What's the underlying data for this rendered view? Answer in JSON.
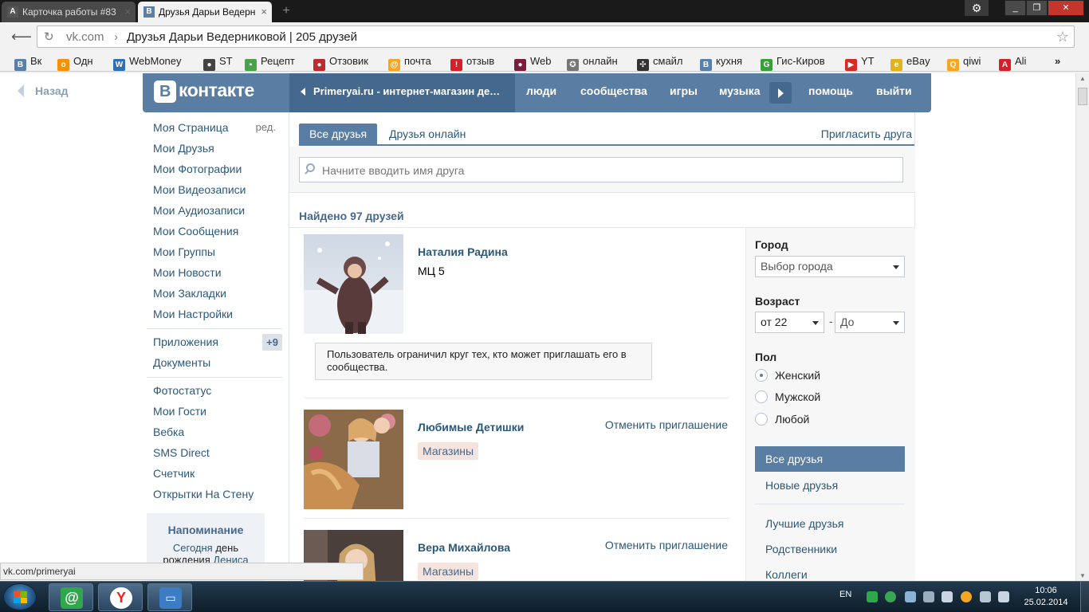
{
  "browser": {
    "tabs": [
      {
        "title": "Карточка работы #83",
        "icon": "А"
      },
      {
        "title": "Друзья Дарьи Ведерн",
        "icon": "В"
      }
    ],
    "address": {
      "host": "vk.com",
      "separator": "›",
      "path": "Друзья Дарьи Ведерниковой | 205 друзей"
    },
    "bookmarks": [
      {
        "label": "Вк",
        "icon": "В",
        "color": "#5b7fa6"
      },
      {
        "label": "Одн",
        "icon": "о",
        "color": "#f2910a"
      },
      {
        "label": "WebMoney",
        "icon": "W",
        "color": "#2f6fb2"
      },
      {
        "label": "ST",
        "icon": "●",
        "color": "#444444"
      },
      {
        "label": "Рецепт",
        "icon": "▪",
        "color": "#4aa34a"
      },
      {
        "label": "Отзовик",
        "icon": "●",
        "color": "#c0282f"
      },
      {
        "label": "почта",
        "icon": "@",
        "color": "#f5a623"
      },
      {
        "label": "отзыв",
        "icon": "!",
        "color": "#d4202a"
      },
      {
        "label": "Web",
        "icon": "●",
        "color": "#7a1e3c"
      },
      {
        "label": "онлайн",
        "icon": "✪",
        "color": "#777777"
      },
      {
        "label": "смайл",
        "icon": "✣",
        "color": "#333333"
      },
      {
        "label": "кухня",
        "icon": "В",
        "color": "#5b7fa6"
      },
      {
        "label": "Гис-Киров",
        "icon": "G",
        "color": "#3c9d3c"
      },
      {
        "label": "YT",
        "icon": "▶",
        "color": "#d62b23"
      },
      {
        "label": "eBay",
        "icon": "e",
        "color": "#e2b41b"
      },
      {
        "label": "qiwi",
        "icon": "Q",
        "color": "#f5a623"
      },
      {
        "label": "Ali",
        "icon": "A",
        "color": "#d4202a"
      }
    ],
    "status_url": "vk.com/primeryai"
  },
  "vk": {
    "back": "Назад",
    "logo_b": "В",
    "logo_text": "контакте",
    "group": "Primeryai.ru - интернет-магазин детской одежды",
    "nav": [
      "люди",
      "сообщества",
      "игры",
      "музыка",
      "помощь",
      "выйти"
    ]
  },
  "left_menu": {
    "edit": "ред.",
    "main": [
      "Моя Страница",
      "Мои Друзья",
      "Мои Фотографии",
      "Мои Видеозаписи",
      "Мои Аудиозаписи",
      "Мои Сообщения",
      "Мои Группы",
      "Мои Новости",
      "Мои Закладки",
      "Мои Настройки"
    ],
    "apps_label": "Приложения",
    "apps_count": "+9",
    "documents": "Документы",
    "extra": [
      "Фотостатус",
      "Мои Гости",
      "Вебка",
      "SMS Direct",
      "Счетчик",
      "Открытки На Стену"
    ]
  },
  "reminder": {
    "title": "Напоминание",
    "text_prefix": "Сегодня",
    "text_mid": "день",
    "text_line2_a": "рождения",
    "text_line2_b": "Дениса"
  },
  "friends": {
    "tabs": {
      "all": "Все друзья",
      "online": "Друзья онлайн",
      "invite": "Пригласить друга"
    },
    "search_placeholder": "Начните вводить имя друга",
    "found": "Найдено 97 друзей",
    "list": [
      {
        "name": "Наталия Радина",
        "sub": "МЦ 5",
        "notice": "Пользователь ограничил круг тех, кто может приглашать его в сообщества."
      },
      {
        "name": "Любимые Детишки",
        "tag": "Магазины",
        "action": "Отменить приглашение"
      },
      {
        "name": "Вера Михайлова",
        "tag": "Магазины",
        "action": "Отменить приглашение"
      }
    ]
  },
  "filters": {
    "city_label": "Город",
    "city_value": "Выбор города",
    "age_label": "Возраст",
    "age_from": "от 22",
    "age_dash": "-",
    "age_to": "До",
    "sex_label": "Пол",
    "sex_options": [
      "Женский",
      "Мужской",
      "Любой"
    ],
    "sex_selected": 0,
    "lists": [
      "Все друзья",
      "Новые друзья",
      "Лучшие друзья",
      "Родственники",
      "Коллеги"
    ]
  },
  "taskbar": {
    "lang": "EN",
    "time": "10:06",
    "date": "25.02.2014"
  }
}
